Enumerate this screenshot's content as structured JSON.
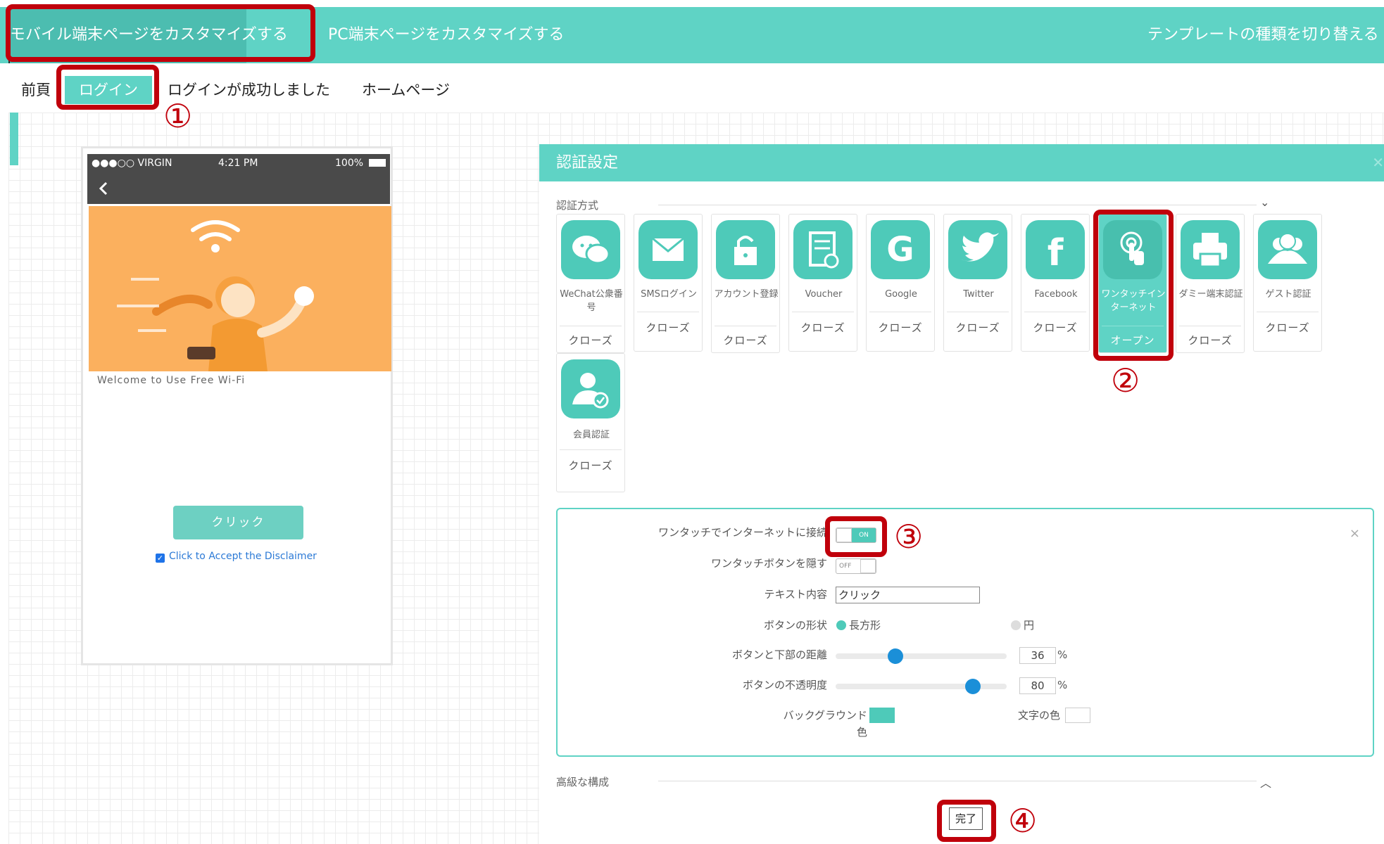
{
  "top_tabs": {
    "mobile": "モバイル端末ページをカスタマイズする",
    "pc": "PC端末ページをカスタマイズする",
    "switch_template": "テンプレートの種類を切り替える"
  },
  "sub_tabs": {
    "prev": "前頁",
    "login": "ログイン",
    "login_success": "ログインが成功しました",
    "home": "ホームページ"
  },
  "phone": {
    "carrier": "●●●○○ VIRGIN",
    "time": "4:21 PM",
    "battery": "100%",
    "welcome": "Welcome to Use Free Wi-Fi",
    "button": "クリック",
    "disclaimer": "Click to Accept the Disclaimer"
  },
  "panel": {
    "title": "認証設定",
    "auth_section": "認証方式",
    "advanced_section": "高級な構成",
    "done": "完了"
  },
  "auth_methods": [
    {
      "name": "WeChat公衆番号",
      "status": "クローズ",
      "icon": "wechat-icon"
    },
    {
      "name": "SMSログイン",
      "status": "クローズ",
      "icon": "mail-icon"
    },
    {
      "name": "アカウント登録",
      "status": "クローズ",
      "icon": "lock-icon"
    },
    {
      "name": "Voucher",
      "status": "クローズ",
      "icon": "voucher-icon"
    },
    {
      "name": "Google",
      "status": "クローズ",
      "icon": "google-icon"
    },
    {
      "name": "Twitter",
      "status": "クローズ",
      "icon": "twitter-icon"
    },
    {
      "name": "Facebook",
      "status": "クローズ",
      "icon": "facebook-icon"
    },
    {
      "name": "ワンタッチインターネット",
      "status": "オープン",
      "icon": "touch-icon"
    },
    {
      "name": "ダミー端末認証",
      "status": "クローズ",
      "icon": "printer-icon"
    },
    {
      "name": "ゲスト認証",
      "status": "クローズ",
      "icon": "guests-icon"
    },
    {
      "name": "会員認証",
      "status": "クローズ",
      "icon": "member-icon"
    }
  ],
  "settings": {
    "one_touch_label": "ワンタッチでインターネットに接続",
    "one_touch_toggle": "ON",
    "hide_button_label": "ワンタッチボタンを隠す",
    "hide_button_toggle": "OFF",
    "text_label": "テキスト内容",
    "text_value": "クリック",
    "shape_label": "ボタンの形状",
    "shape_rect": "長方形",
    "shape_circle": "円",
    "distance_label": "ボタンと下部の距離",
    "distance_value": "36",
    "opacity_label": "ボタンの不透明度",
    "opacity_value": "80",
    "percent": "%",
    "bg_color_label": "バックグラウンド",
    "bg_color_label2": "色",
    "text_color_label": "文字の色",
    "bg_color": "#4ecab9",
    "text_color": "#ffffff"
  },
  "annotations": [
    "①",
    "②",
    "③",
    "④"
  ],
  "colors": {
    "accent": "#5fd3c5",
    "highlight": "#c0000b",
    "phone_hero": "#fbb05e"
  }
}
